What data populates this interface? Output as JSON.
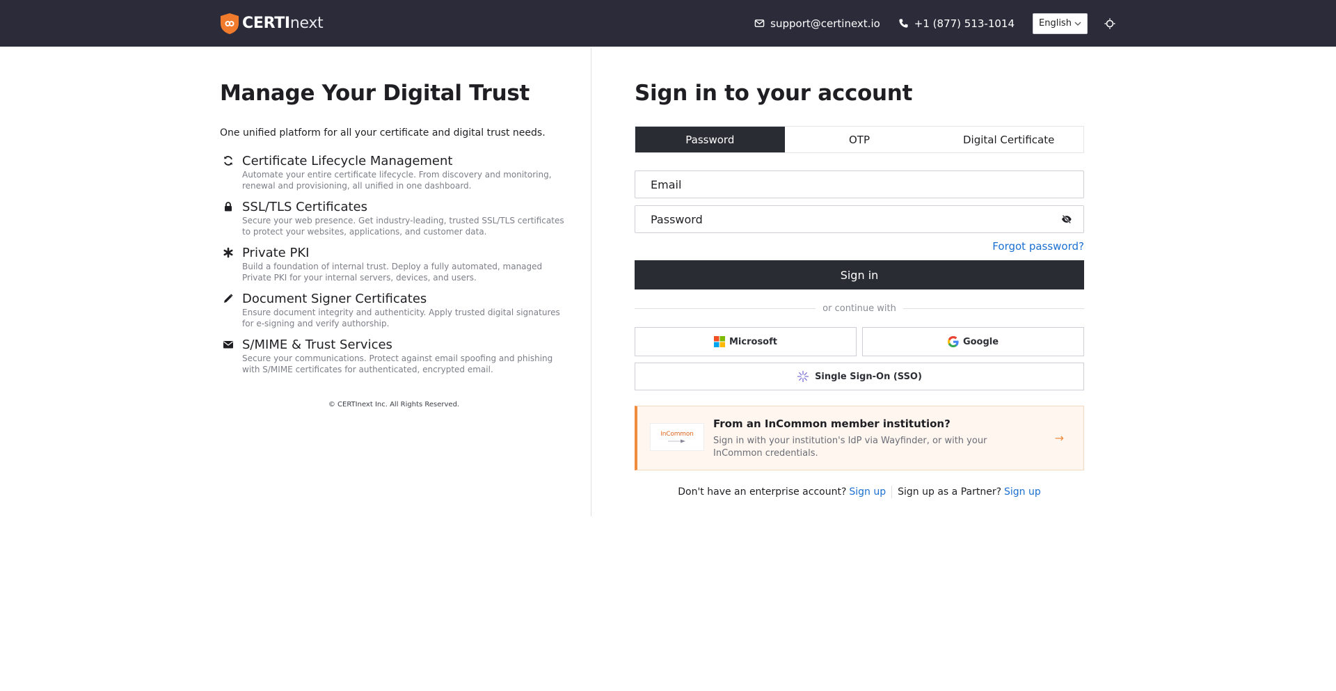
{
  "header": {
    "brand_bold": "CERTI",
    "brand_light": "next",
    "email": "support@certinext.io",
    "phone": "+1 (877) 513-1014",
    "language": "English"
  },
  "left": {
    "title": "Manage Your Digital Trust",
    "subtitle": "One unified platform for all your certificate and digital trust needs.",
    "features": [
      {
        "icon": "refresh-icon",
        "title": "Certificate Lifecycle Management",
        "desc": "Automate your entire certificate lifecycle. From discovery and monitoring, renewal and provisioning, all unified in one dashboard."
      },
      {
        "icon": "lock-icon",
        "title": "SSL/TLS Certificates",
        "desc": "Secure your web presence. Get industry-leading, trusted SSL/TLS certificates to protect your websites, applications, and customer data."
      },
      {
        "icon": "asterisk-icon",
        "title": "Private PKI",
        "desc": "Build a foundation of internal trust. Deploy a fully automated, managed Private PKI for your internal servers, devices, and users."
      },
      {
        "icon": "pencil-icon",
        "title": "Document Signer Certificates",
        "desc": "Ensure document integrity and authenticity. Apply trusted digital signatures for e-signing and verify authorship."
      },
      {
        "icon": "envelope-icon",
        "title": "S/MIME & Trust Services",
        "desc": "Secure your communications. Protect against email spoofing and phishing with S/MIME certificates for authenticated, encrypted email."
      }
    ],
    "copyright": "© CERTInext Inc. All Rights Reserved."
  },
  "signin": {
    "title": "Sign in to your account",
    "tabs": [
      "Password",
      "OTP",
      "Digital Certificate"
    ],
    "active_tab": "Password",
    "email_placeholder": "Email",
    "password_placeholder": "Password",
    "forgot": "Forgot password?",
    "submit": "Sign in",
    "divider": "or continue with",
    "microsoft": "Microsoft",
    "google": "Google",
    "sso": "Single Sign-On (SSO)"
  },
  "incommon": {
    "logo_text": "InCommon",
    "title": "From an InCommon member institution?",
    "desc": "Sign in with your institution's IdP via Wayfinder, or with your InCommon credentials.",
    "arrow": "→"
  },
  "signup": {
    "enterprise_text": "Don't have an enterprise account?",
    "enterprise_link": "Sign up",
    "partner_text": "Sign up as a Partner?",
    "partner_link": "Sign up"
  },
  "colors": {
    "header_bg": "#2c2b3a",
    "primary_dark": "#2a2c33",
    "link_blue": "#1a6fd1",
    "accent_orange": "#f08a3c"
  }
}
